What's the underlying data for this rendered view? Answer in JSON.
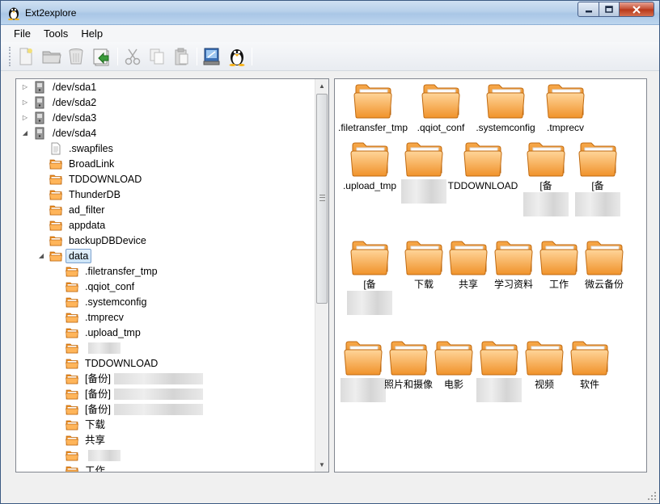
{
  "window": {
    "title": "Ext2explore"
  },
  "menu": [
    {
      "label": "File"
    },
    {
      "label": "Tools"
    },
    {
      "label": "Help"
    }
  ],
  "toolbar": {
    "buttons": [
      {
        "icon": "new-file-icon"
      },
      {
        "icon": "open-folder-icon"
      },
      {
        "icon": "delete-icon"
      },
      {
        "icon": "save-export-icon"
      },
      {
        "icon": "cut-icon"
      },
      {
        "icon": "copy-icon"
      },
      {
        "icon": "paste-icon"
      },
      {
        "icon": "disk-tool-icon"
      },
      {
        "icon": "linux-tux-icon"
      }
    ]
  },
  "tree": {
    "items": [
      {
        "label": "/dev/sda1",
        "type": "drive",
        "level": 0,
        "expander": "collapsed"
      },
      {
        "label": "/dev/sda2",
        "type": "drive",
        "level": 0,
        "expander": "collapsed"
      },
      {
        "label": "/dev/sda3",
        "type": "drive",
        "level": 0,
        "expander": "collapsed"
      },
      {
        "label": "/dev/sda4",
        "type": "drive",
        "level": 0,
        "expander": "expanded"
      },
      {
        "label": ".swapfiles",
        "type": "file",
        "level": 1
      },
      {
        "label": "BroadLink",
        "type": "folder",
        "level": 1
      },
      {
        "label": "TDDOWNLOAD",
        "type": "folder",
        "level": 1
      },
      {
        "label": "ThunderDB",
        "type": "folder",
        "level": 1
      },
      {
        "label": "ad_filter",
        "type": "folder",
        "level": 1
      },
      {
        "label": "appdata",
        "type": "folder",
        "level": 1
      },
      {
        "label": "backupDBDevice",
        "type": "folder",
        "level": 1
      },
      {
        "label": "data",
        "type": "folder",
        "level": 1,
        "expander": "expanded",
        "selected": true
      },
      {
        "label": ".filetransfer_tmp",
        "type": "folder",
        "level": 2
      },
      {
        "label": ".qqiot_conf",
        "type": "folder",
        "level": 2
      },
      {
        "label": ".systemconfig",
        "type": "folder",
        "level": 2
      },
      {
        "label": ".tmprecv",
        "type": "folder",
        "level": 2
      },
      {
        "label": ".upload_tmp",
        "type": "folder",
        "level": 2
      },
      {
        "label": "",
        "type": "folder",
        "level": 2,
        "redacted": true
      },
      {
        "label": "TDDOWNLOAD",
        "type": "folder",
        "level": 2
      },
      {
        "label": "[备份]",
        "type": "folder",
        "level": 2,
        "redacted": true
      },
      {
        "label": "[备份]",
        "type": "folder",
        "level": 2,
        "redacted": true
      },
      {
        "label": "[备份]",
        "type": "folder",
        "level": 2,
        "redacted": true
      },
      {
        "label": "下载",
        "type": "folder",
        "level": 2
      },
      {
        "label": "共享",
        "type": "folder",
        "level": 2
      },
      {
        "label": "",
        "type": "folder",
        "level": 2,
        "redacted": true
      },
      {
        "label": "工作",
        "type": "folder",
        "level": 2
      }
    ]
  },
  "icons": {
    "items": [
      {
        "label": ".filetransfer_tmp"
      },
      {
        "label": ".qqiot_conf"
      },
      {
        "label": ".systemconfig"
      },
      {
        "label": ".tmprecv"
      },
      {
        "label": ".upload_tmp"
      },
      {
        "label": "",
        "redacted": true
      },
      {
        "label": "TDDOWNLOAD"
      },
      {
        "label": "[备",
        "redacted": true
      },
      {
        "label": "[备",
        "redacted": true
      },
      {
        "label": "[备",
        "redacted": true
      },
      {
        "label": "下载"
      },
      {
        "label": "共享"
      },
      {
        "label": "学习资料"
      },
      {
        "label": "工作"
      },
      {
        "label": "微云备份"
      },
      {
        "label": "",
        "redacted": true
      },
      {
        "label": "照片和摄像"
      },
      {
        "label": "电影"
      },
      {
        "label": "",
        "redacted": true
      },
      {
        "label": "视频"
      },
      {
        "label": "软件"
      }
    ]
  },
  "colors": {
    "folder_light": "#ffc87a",
    "folder_dark": "#e88a1a",
    "selection_border": "#7da2ce"
  }
}
